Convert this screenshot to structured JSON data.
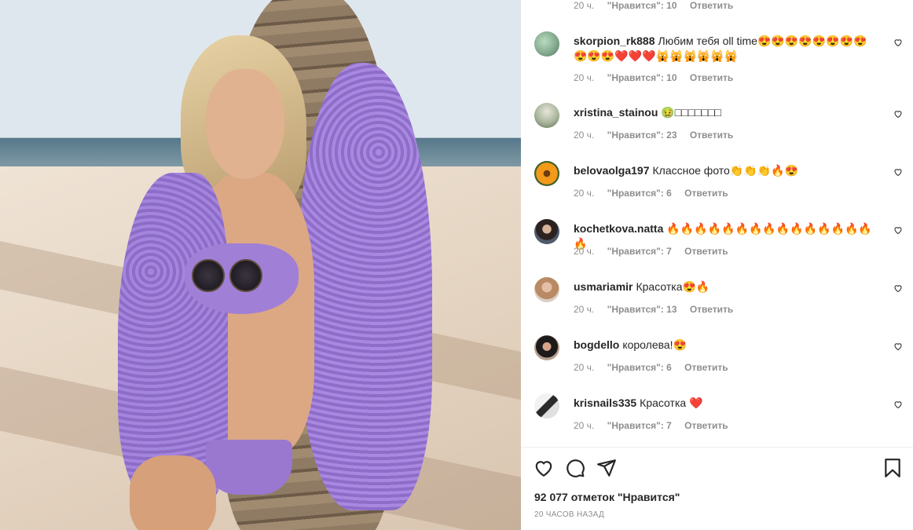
{
  "post": {
    "alt": "Photo: woman in lilac lace cover-up leaning on palm tree on beach"
  },
  "top_partial": {
    "time": "20 ч.",
    "likes": "\"Нравится\": 10",
    "reply": "Ответить"
  },
  "comments": [
    {
      "user": "skorpion_rk888",
      "text": "Любим тебя oll time😍😍😍😍😍😍😍😍😍😍😍❤️❤️❤️🙀🙀🙀🙀🙀🙀",
      "time": "20 ч.",
      "likes": "\"Нравится\": 10",
      "reply": "Ответить"
    },
    {
      "user": "xristina_stainou",
      "text": "🤢□□□□□□□",
      "time": "20 ч.",
      "likes": "\"Нравится\": 23",
      "reply": "Ответить"
    },
    {
      "user": "belovaolga197",
      "text": "Классное фото👏👏👏🔥😍",
      "time": "20 ч.",
      "likes": "\"Нравится\": 6",
      "reply": "Ответить"
    },
    {
      "user": "kochetkova.natta",
      "text": "🔥🔥🔥🔥🔥🔥🔥🔥🔥🔥🔥🔥🔥🔥🔥🔥",
      "time": "20 ч.",
      "likes": "\"Нравится\": 7",
      "reply": "Ответить"
    },
    {
      "user": "usmariamir",
      "text": "Красотка😍🔥",
      "time": "20 ч.",
      "likes": "\"Нравится\": 13",
      "reply": "Ответить"
    },
    {
      "user": "bogdello",
      "text": "королева!😍",
      "time": "20 ч.",
      "likes": "\"Нравится\": 6",
      "reply": "Ответить"
    },
    {
      "user": "krisnails335",
      "text": "Красотка ❤️",
      "time": "20 ч.",
      "likes": "\"Нравится\": 7",
      "reply": "Ответить"
    }
  ],
  "footer": {
    "likes_count": "92 077 отметок \"Нравится\"",
    "timestamp": "20 ЧАСОВ НАЗАД"
  },
  "colors": {
    "text": "#262626",
    "muted": "#8e8e8e",
    "divider": "#efefef"
  },
  "icons": [
    "heart-icon",
    "comment-icon",
    "share-icon",
    "bookmark-icon"
  ]
}
